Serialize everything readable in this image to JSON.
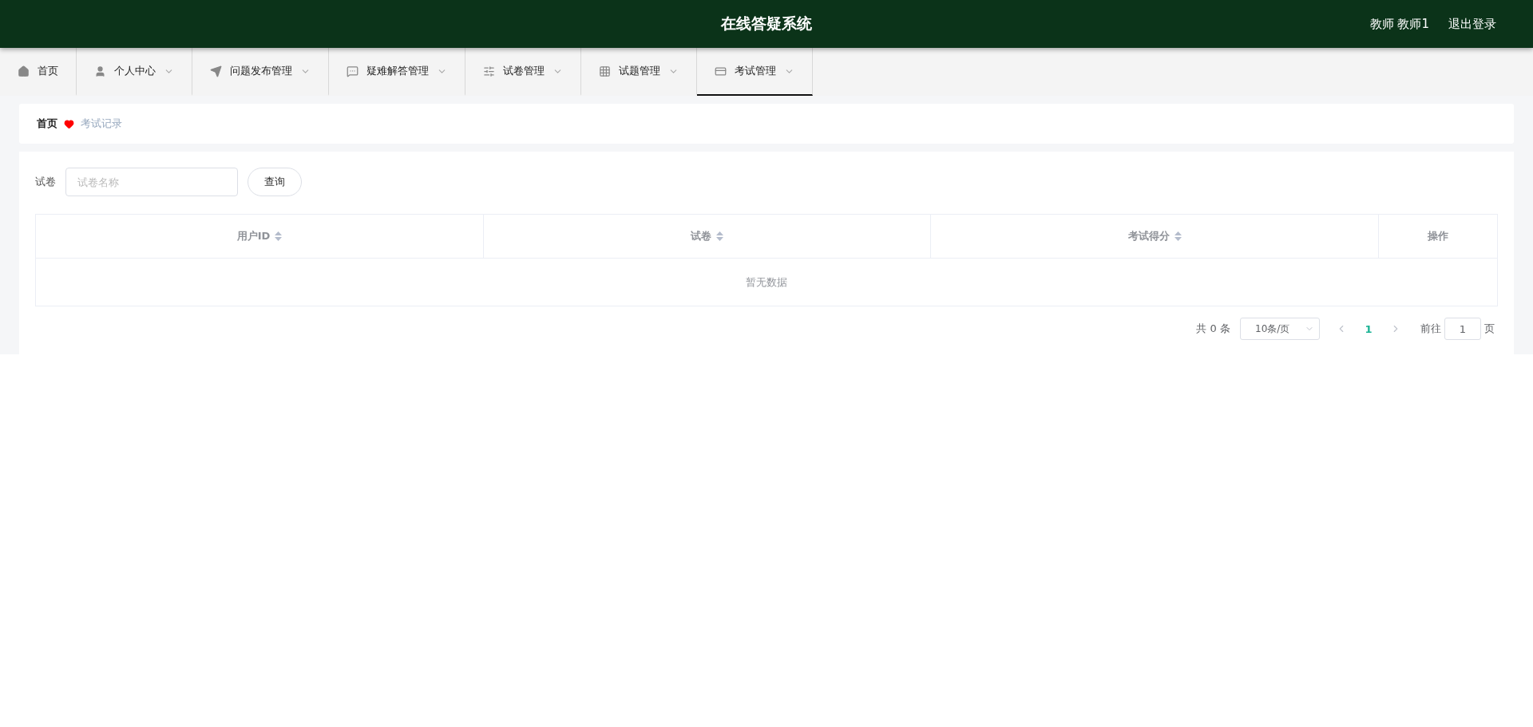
{
  "header": {
    "title": "在线答疑系统",
    "user": "教师 教师1",
    "logout": "退出登录"
  },
  "nav": [
    {
      "label": "首页",
      "dropdown": false,
      "selected": false
    },
    {
      "label": "个人中心",
      "dropdown": true,
      "selected": false
    },
    {
      "label": "问题发布管理",
      "dropdown": true,
      "selected": false
    },
    {
      "label": "疑难解答管理",
      "dropdown": true,
      "selected": false
    },
    {
      "label": "试卷管理",
      "dropdown": true,
      "selected": false
    },
    {
      "label": "试题管理",
      "dropdown": true,
      "selected": false
    },
    {
      "label": "考试管理",
      "dropdown": true,
      "selected": true
    }
  ],
  "breadcrumb": {
    "home": "首页",
    "current": "考试记录"
  },
  "filter": {
    "label": "试卷",
    "placeholder": "试卷名称",
    "button": "查询"
  },
  "table": {
    "columns": [
      {
        "label": "用户ID",
        "sortable": true
      },
      {
        "label": "试卷",
        "sortable": true
      },
      {
        "label": "考试得分",
        "sortable": true
      },
      {
        "label": "操作",
        "sortable": false
      }
    ],
    "empty": "暂无数据"
  },
  "pagination": {
    "total": "共 0 条",
    "page_size": "10条/页",
    "pages": [
      {
        "label": "1",
        "selected": true
      }
    ],
    "goto": "前往",
    "goto_value": "1",
    "goto_suffix": "页"
  }
}
